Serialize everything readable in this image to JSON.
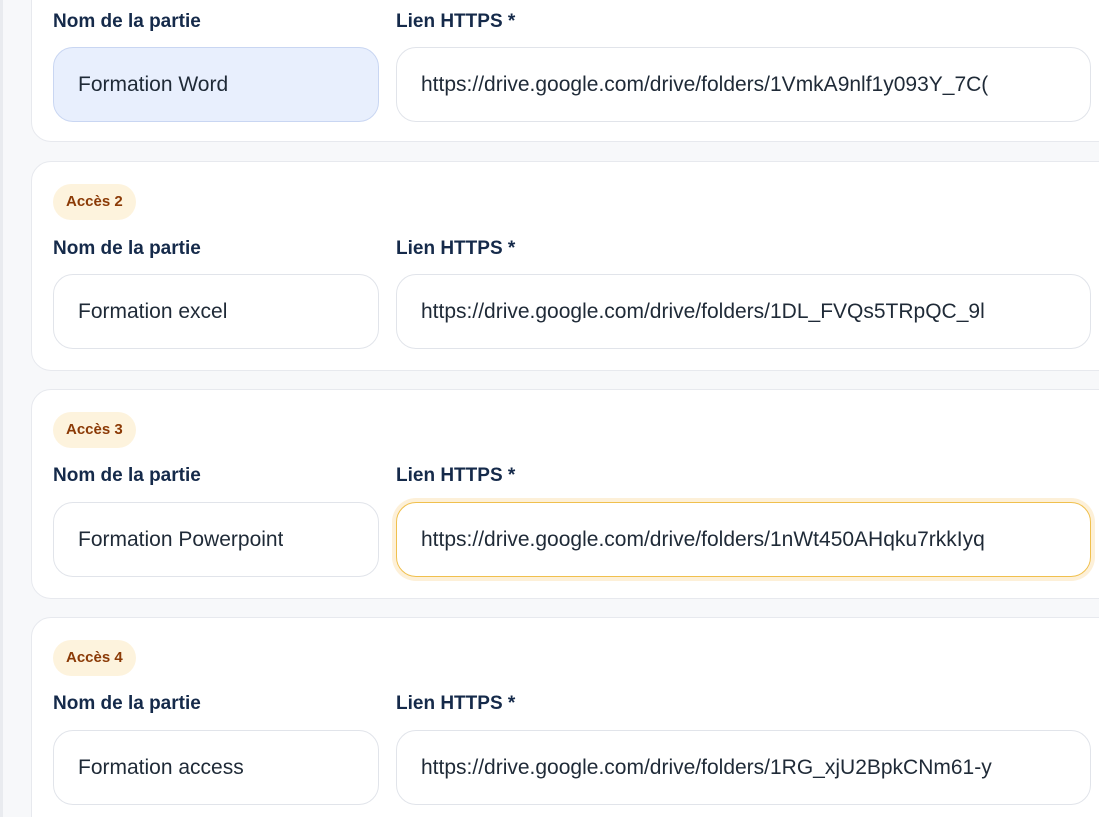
{
  "labels": {
    "name_label": "Nom de la partie",
    "url_label": "Lien HTTPS *"
  },
  "accesses": [
    {
      "badge": "",
      "name_value": "Formation Word",
      "url_value": "https://drive.google.com/drive/folders/1VmkA9nlf1y093Y_7C("
    },
    {
      "badge": "Accès 2",
      "name_value": "Formation excel",
      "url_value": "https://drive.google.com/drive/folders/1DL_FVQs5TRpQC_9l"
    },
    {
      "badge": "Accès 3",
      "name_value": "Formation Powerpoint",
      "url_value": "https://drive.google.com/drive/folders/1nWt450AHqku7rkkIyq"
    },
    {
      "badge": "Accès 4",
      "name_value": "Formation access",
      "url_value": "https://drive.google.com/drive/folders/1RG_xjU2BpkCNm61-y"
    }
  ],
  "colors": {
    "badge_bg": "#fdf3dd",
    "badge_text": "#8b3a06",
    "label_text": "#152a4a",
    "selected_bg": "#e8effd",
    "focus_border": "#f0c04e"
  }
}
